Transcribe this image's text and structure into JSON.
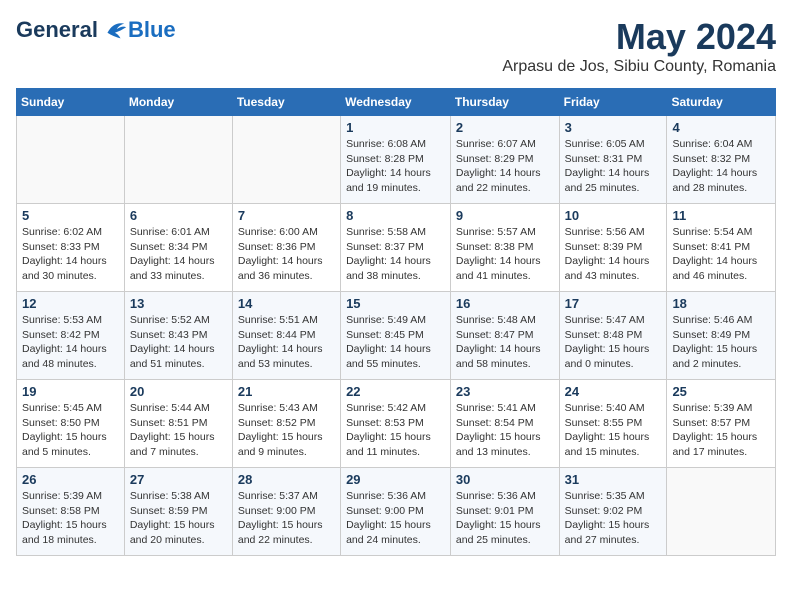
{
  "logo": {
    "general": "General",
    "blue": "Blue"
  },
  "title": "May 2024",
  "subtitle": "Arpasu de Jos, Sibiu County, Romania",
  "days_header": [
    "Sunday",
    "Monday",
    "Tuesday",
    "Wednesday",
    "Thursday",
    "Friday",
    "Saturday"
  ],
  "weeks": [
    [
      {
        "day": "",
        "info": ""
      },
      {
        "day": "",
        "info": ""
      },
      {
        "day": "",
        "info": ""
      },
      {
        "day": "1",
        "info": "Sunrise: 6:08 AM\nSunset: 8:28 PM\nDaylight: 14 hours\nand 19 minutes."
      },
      {
        "day": "2",
        "info": "Sunrise: 6:07 AM\nSunset: 8:29 PM\nDaylight: 14 hours\nand 22 minutes."
      },
      {
        "day": "3",
        "info": "Sunrise: 6:05 AM\nSunset: 8:31 PM\nDaylight: 14 hours\nand 25 minutes."
      },
      {
        "day": "4",
        "info": "Sunrise: 6:04 AM\nSunset: 8:32 PM\nDaylight: 14 hours\nand 28 minutes."
      }
    ],
    [
      {
        "day": "5",
        "info": "Sunrise: 6:02 AM\nSunset: 8:33 PM\nDaylight: 14 hours\nand 30 minutes."
      },
      {
        "day": "6",
        "info": "Sunrise: 6:01 AM\nSunset: 8:34 PM\nDaylight: 14 hours\nand 33 minutes."
      },
      {
        "day": "7",
        "info": "Sunrise: 6:00 AM\nSunset: 8:36 PM\nDaylight: 14 hours\nand 36 minutes."
      },
      {
        "day": "8",
        "info": "Sunrise: 5:58 AM\nSunset: 8:37 PM\nDaylight: 14 hours\nand 38 minutes."
      },
      {
        "day": "9",
        "info": "Sunrise: 5:57 AM\nSunset: 8:38 PM\nDaylight: 14 hours\nand 41 minutes."
      },
      {
        "day": "10",
        "info": "Sunrise: 5:56 AM\nSunset: 8:39 PM\nDaylight: 14 hours\nand 43 minutes."
      },
      {
        "day": "11",
        "info": "Sunrise: 5:54 AM\nSunset: 8:41 PM\nDaylight: 14 hours\nand 46 minutes."
      }
    ],
    [
      {
        "day": "12",
        "info": "Sunrise: 5:53 AM\nSunset: 8:42 PM\nDaylight: 14 hours\nand 48 minutes."
      },
      {
        "day": "13",
        "info": "Sunrise: 5:52 AM\nSunset: 8:43 PM\nDaylight: 14 hours\nand 51 minutes."
      },
      {
        "day": "14",
        "info": "Sunrise: 5:51 AM\nSunset: 8:44 PM\nDaylight: 14 hours\nand 53 minutes."
      },
      {
        "day": "15",
        "info": "Sunrise: 5:49 AM\nSunset: 8:45 PM\nDaylight: 14 hours\nand 55 minutes."
      },
      {
        "day": "16",
        "info": "Sunrise: 5:48 AM\nSunset: 8:47 PM\nDaylight: 14 hours\nand 58 minutes."
      },
      {
        "day": "17",
        "info": "Sunrise: 5:47 AM\nSunset: 8:48 PM\nDaylight: 15 hours\nand 0 minutes."
      },
      {
        "day": "18",
        "info": "Sunrise: 5:46 AM\nSunset: 8:49 PM\nDaylight: 15 hours\nand 2 minutes."
      }
    ],
    [
      {
        "day": "19",
        "info": "Sunrise: 5:45 AM\nSunset: 8:50 PM\nDaylight: 15 hours\nand 5 minutes."
      },
      {
        "day": "20",
        "info": "Sunrise: 5:44 AM\nSunset: 8:51 PM\nDaylight: 15 hours\nand 7 minutes."
      },
      {
        "day": "21",
        "info": "Sunrise: 5:43 AM\nSunset: 8:52 PM\nDaylight: 15 hours\nand 9 minutes."
      },
      {
        "day": "22",
        "info": "Sunrise: 5:42 AM\nSunset: 8:53 PM\nDaylight: 15 hours\nand 11 minutes."
      },
      {
        "day": "23",
        "info": "Sunrise: 5:41 AM\nSunset: 8:54 PM\nDaylight: 15 hours\nand 13 minutes."
      },
      {
        "day": "24",
        "info": "Sunrise: 5:40 AM\nSunset: 8:55 PM\nDaylight: 15 hours\nand 15 minutes."
      },
      {
        "day": "25",
        "info": "Sunrise: 5:39 AM\nSunset: 8:57 PM\nDaylight: 15 hours\nand 17 minutes."
      }
    ],
    [
      {
        "day": "26",
        "info": "Sunrise: 5:39 AM\nSunset: 8:58 PM\nDaylight: 15 hours\nand 18 minutes."
      },
      {
        "day": "27",
        "info": "Sunrise: 5:38 AM\nSunset: 8:59 PM\nDaylight: 15 hours\nand 20 minutes."
      },
      {
        "day": "28",
        "info": "Sunrise: 5:37 AM\nSunset: 9:00 PM\nDaylight: 15 hours\nand 22 minutes."
      },
      {
        "day": "29",
        "info": "Sunrise: 5:36 AM\nSunset: 9:00 PM\nDaylight: 15 hours\nand 24 minutes."
      },
      {
        "day": "30",
        "info": "Sunrise: 5:36 AM\nSunset: 9:01 PM\nDaylight: 15 hours\nand 25 minutes."
      },
      {
        "day": "31",
        "info": "Sunrise: 5:35 AM\nSunset: 9:02 PM\nDaylight: 15 hours\nand 27 minutes."
      },
      {
        "day": "",
        "info": ""
      }
    ]
  ]
}
